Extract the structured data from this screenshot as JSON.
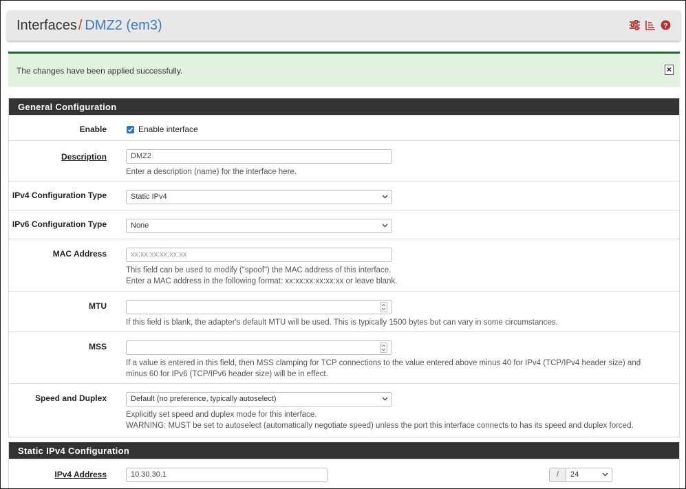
{
  "header": {
    "title": "Interfaces",
    "separator": "/",
    "current": "DMZ2 (em3)",
    "icons": [
      "sliders-icon",
      "list-chart-icon",
      "help-icon"
    ]
  },
  "alert": {
    "message": "The changes have been applied successfully.",
    "close": "×"
  },
  "general": {
    "heading": "General Configuration",
    "enable_label": "Enable",
    "enable_checkbox_label": "Enable interface",
    "enable_checked": true,
    "description_label": "Description",
    "description_value": "DMZ2",
    "description_help": "Enter a description (name) for the interface here.",
    "ipv4_type_label": "IPv4 Configuration Type",
    "ipv4_type_value": "Static IPv4",
    "ipv6_type_label": "IPv6 Configuration Type",
    "ipv6_type_value": "None",
    "mac_label": "MAC Address",
    "mac_placeholder": "xx:xx:xx:xx:xx:xx",
    "mac_help_1": "This field can be used to modify (\"spoof\") the MAC address of this interface.",
    "mac_help_2": "Enter a MAC address in the following format: xx:xx:xx:xx:xx:xx or leave blank.",
    "mtu_label": "MTU",
    "mtu_value": "",
    "mtu_help": "If this field is blank, the adapter's default MTU will be used. This is typically 1500 bytes but can vary in some circumstances.",
    "mss_label": "MSS",
    "mss_value": "",
    "mss_help_1": "If a value is entered in this field, then MSS clamping for TCP connections to the value entered above minus 40 for IPv4 (TCP/IPv4 header size) and",
    "mss_help_2": "minus 60 for IPv6 (TCP/IPv6 header size) will be in effect.",
    "speed_label": "Speed and Duplex",
    "speed_value": "Default (no preference, typically autoselect)",
    "speed_help_1": "Explicitly set speed and duplex mode for this interface.",
    "speed_help_2": "WARNING: MUST be set to autoselect (automatically negotiate speed) unless the port this interface connects to has its speed and duplex forced."
  },
  "static": {
    "heading": "Static IPv4 Configuration",
    "ipv4_label": "IPv4 Address",
    "ipv4_value": "10.30.30.1",
    "cidr_sep": "/",
    "cidr_value": "24"
  },
  "colors": {
    "accent": "#3a7bbf",
    "danger": "#b33333",
    "success_bg": "#e3f1e0",
    "success_border": "#1f6b2f",
    "panel_heading": "#333333"
  }
}
